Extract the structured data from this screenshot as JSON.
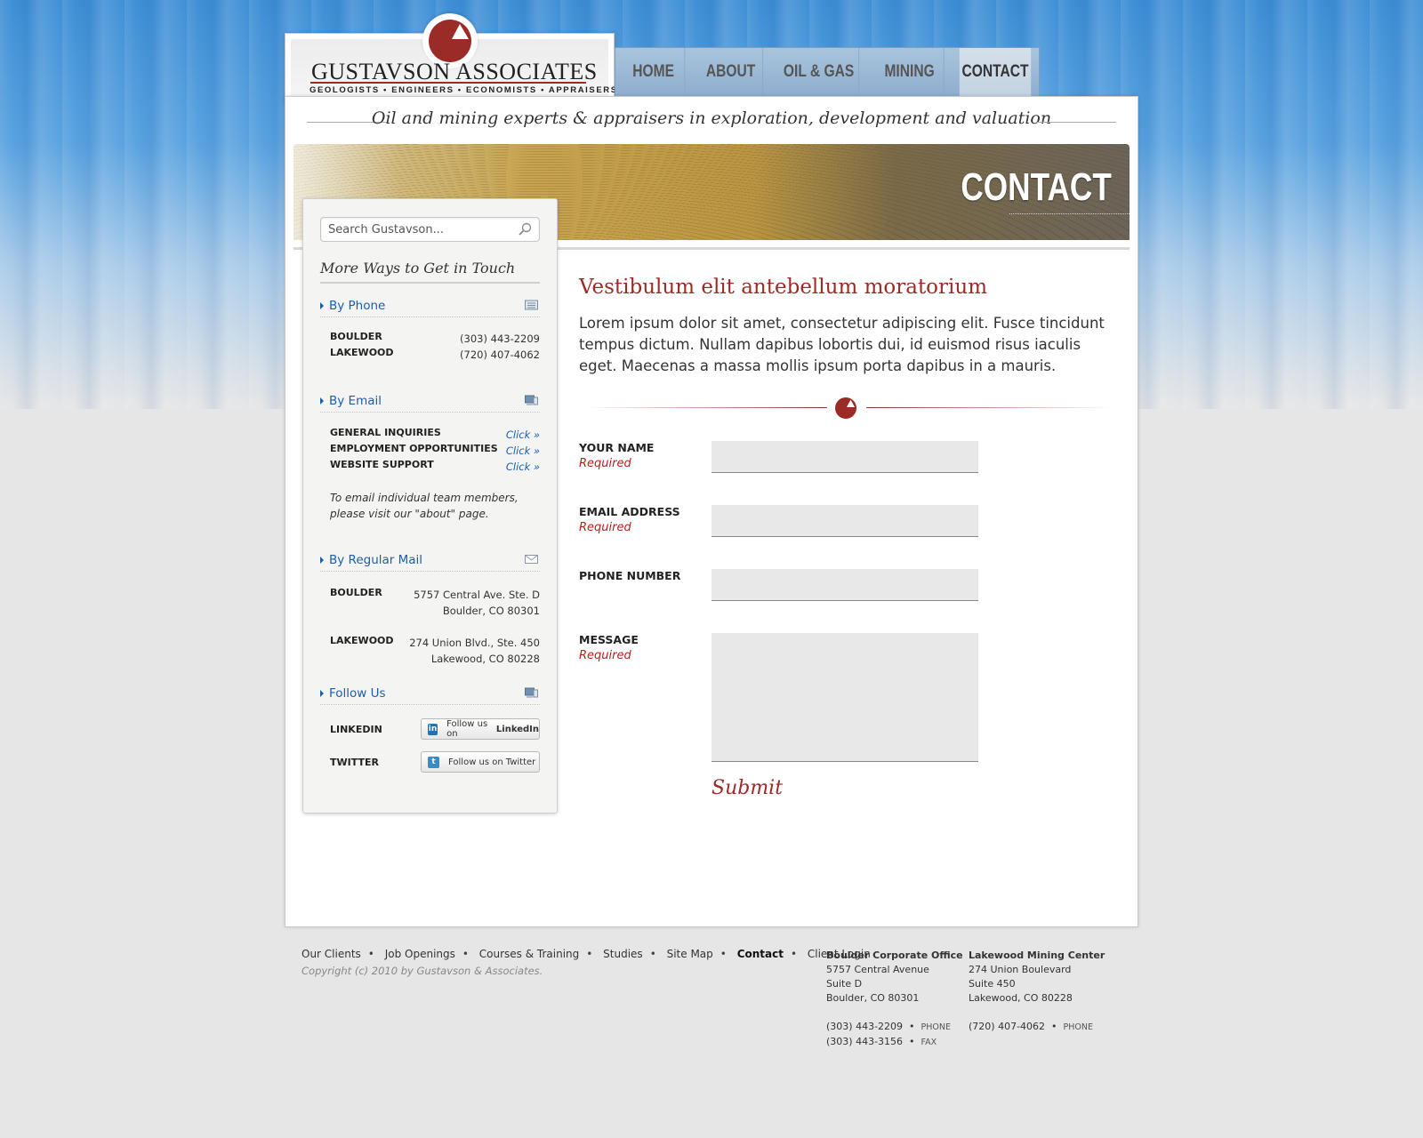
{
  "logo": {
    "name": "GUSTAVSON ASSOCIATES",
    "subtitle": "GEOLOGISTS • ENGINEERS • ECONOMISTS • APPRAISERS"
  },
  "nav": {
    "items": [
      {
        "label": "HOME"
      },
      {
        "label": "ABOUT"
      },
      {
        "label": "OIL & GAS"
      },
      {
        "label": "MINING"
      },
      {
        "label": "CONTACT",
        "active": true
      }
    ]
  },
  "tagline": "Oil and mining experts & appraisers in exploration, development and valuation",
  "banner": {
    "title": "CONTACT"
  },
  "sidebar": {
    "search_placeholder": "Search Gustavson...",
    "title": "More Ways to Get in Touch",
    "phone": {
      "heading": "By Phone",
      "rows": [
        {
          "k": "BOULDER",
          "v": "(303) 443-2209"
        },
        {
          "k": "LAKEWOOD",
          "v": "(720) 407-4062"
        }
      ]
    },
    "email": {
      "heading": "By Email",
      "rows": [
        {
          "k": "GENERAL INQUIRIES",
          "v": "Click »"
        },
        {
          "k": "EMPLOYMENT OPPORTUNITIES",
          "v": "Click »"
        },
        {
          "k": "WEBSITE SUPPORT",
          "v": "Click »"
        }
      ],
      "note": "To email individual team members, please visit our \"about\" page."
    },
    "mail": {
      "heading": "By Regular Mail",
      "rows": [
        {
          "k": "BOULDER",
          "line1": "5757 Central Ave. Ste. D",
          "line2": "Boulder, CO 80301"
        },
        {
          "k": "LAKEWOOD",
          "line1": "274 Union Blvd., Ste. 450",
          "line2": "Lakewood, CO 80228"
        }
      ]
    },
    "follow": {
      "heading": "Follow Us",
      "rows": [
        {
          "k": "LINKEDIN",
          "prefix": "Follow us on",
          "brand": "LinkedIn",
          "icon": "in"
        },
        {
          "k": "TWITTER",
          "prefix": "Follow us on",
          "brand": "Twitter",
          "icon": "t"
        }
      ]
    }
  },
  "content": {
    "title": "Vestibulum elit antebellum moratorium",
    "body": "Lorem ipsum dolor sit amet, consectetur adipiscing elit. Fusce tincidunt tempus dictum. Nullam dapibus lobortis dui, id euismod risus iaculis eget. Maecenas a massa mollis ipsum porta dapibus in a mauris."
  },
  "form": {
    "required_label": "Required",
    "name_label": "YOUR NAME",
    "email_label": "EMAIL ADDRESS",
    "phone_label": "PHONE NUMBER",
    "message_label": "MESSAGE",
    "submit_label": "Submit"
  },
  "footer": {
    "links": [
      "Our Clients",
      "Job Openings",
      "Courses & Training",
      "Studies",
      "Site Map",
      "Contact",
      "Client Login"
    ],
    "current": "Contact",
    "copyright": "Copyright (c) 2010 by Gustavson & Associates.",
    "boulder": {
      "title": "Boulder Corporate Office",
      "line1": "5757 Central Avenue",
      "line2": "Suite D",
      "line3": "Boulder, CO 80301",
      "phone": "(303) 443-2209",
      "phone_label": "PHONE",
      "fax": "(303) 443-3156",
      "fax_label": "FAX"
    },
    "lakewood": {
      "title": "Lakewood Mining Center",
      "line1": "274 Union Boulevard",
      "line2": "Suite 450",
      "line3": "Lakewood, CO 80228",
      "phone": "(720) 407-4062",
      "phone_label": "PHONE"
    }
  },
  "colors": {
    "accent": "#9b2b26",
    "link": "#1a5fa8",
    "nav": "#8eaed0"
  }
}
